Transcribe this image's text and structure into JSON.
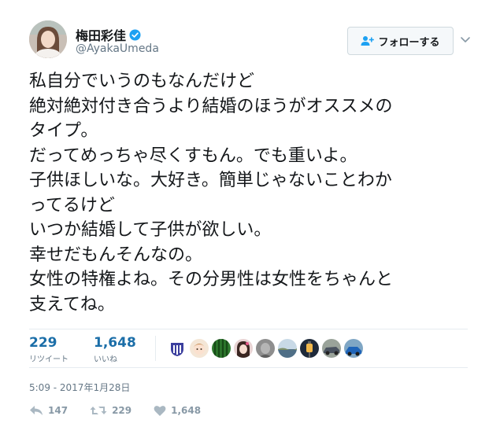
{
  "colors": {
    "name_text": "#14171a",
    "secondary_text": "#657786",
    "stat_value": "#1b6ea8",
    "verified": "#1da1f2",
    "action_icon": "#aab8c2",
    "divider": "#e6ecf0"
  },
  "author": {
    "display_name": "梅田彩佳",
    "handle": "@AyakaUmeda",
    "verified": true,
    "avatar": "avatar-photo"
  },
  "follow_button": {
    "label": "フォローする",
    "icon": "add-user-icon"
  },
  "menu": {
    "icon": "chevron-down-icon"
  },
  "tweet": {
    "lines": [
      "私自分でいうのもなんだけど",
      "絶対絶対付き合うより結婚のほうがオススメの",
      "タイプ。",
      "だってめっちゃ尽くすもん。でも重いよ。",
      "子供ほしいな。大好き。簡単じゃないことわか",
      "ってるけど",
      "いつか結婚して子供が欲しい。",
      "幸せだもんそんなの。",
      "女性の特権よね。その分男性は女性をちゃんと",
      "支えてね。"
    ]
  },
  "stats": {
    "retweets": {
      "value": "229",
      "label": "リツイート"
    },
    "likes": {
      "value": "1,648",
      "label": "いいね"
    }
  },
  "liker_avatars": [
    "team-badge",
    "cartoon-avatar",
    "watermelon",
    "girl-photo",
    "gray-portrait",
    "coastline-photo",
    "lantern-photo",
    "car-photo",
    "blue-car-photo"
  ],
  "timestamp": "5:09 - 2017年1月28日",
  "actions": {
    "reply": {
      "icon": "reply-icon",
      "count": "147"
    },
    "retweet": {
      "icon": "retweet-icon",
      "count": "229"
    },
    "like": {
      "icon": "heart-icon",
      "count": "1,648"
    }
  }
}
